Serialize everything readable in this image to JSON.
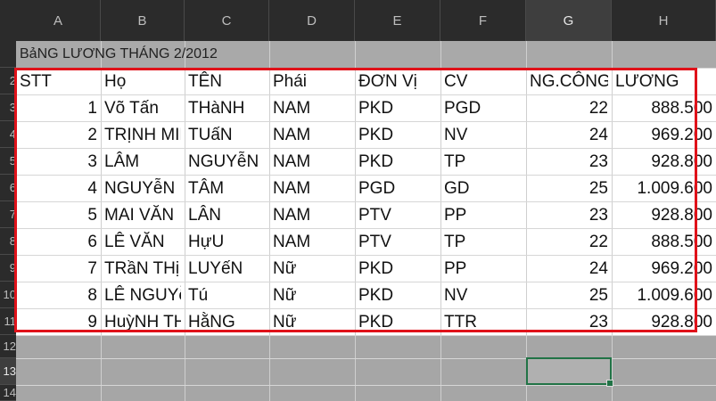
{
  "columns": [
    "A",
    "B",
    "C",
    "D",
    "E",
    "F",
    "G",
    "H"
  ],
  "row_numbers": [
    "",
    "2",
    "3",
    "4",
    "5",
    "6",
    "7",
    "8",
    "9",
    "10",
    "11",
    "12",
    "13",
    "14"
  ],
  "title": "BảNG LƯƠNG THÁNG 2/2012",
  "headers": [
    "STT",
    "Họ",
    "TÊN",
    "Phái",
    "ĐƠN Vị",
    "CV",
    "NG.CÔNG",
    "LƯƠNG"
  ],
  "rows": [
    [
      "1",
      "Võ Tấn",
      "THàNH",
      "NAM",
      "PKD",
      "PGD",
      "22",
      "888.500"
    ],
    [
      "2",
      "TRỊNH MIN",
      "TUấN",
      "NAM",
      "PKD",
      "NV",
      "24",
      "969.200"
    ],
    [
      "3",
      "LÂM",
      "NGUYễN",
      "NAM",
      "PKD",
      "TP",
      "23",
      "928.800"
    ],
    [
      "4",
      "NGUYễN N",
      "TÂM",
      "NAM",
      "PGD",
      "GD",
      "25",
      "1.009.600"
    ],
    [
      "5",
      "MAI VĂN",
      "LÂN",
      "NAM",
      "PTV",
      "PP",
      "23",
      "928.800"
    ],
    [
      "6",
      "LÊ VĂN",
      "HựU",
      "NAM",
      "PTV",
      "TP",
      "22",
      "888.500"
    ],
    [
      "7",
      "TRầN THị",
      "LUYếN",
      "Nữ",
      "PKD",
      "PP",
      "24",
      "969.200"
    ],
    [
      "8",
      "LÊ NGUYễ",
      "Tú",
      "Nữ",
      "PKD",
      "NV",
      "25",
      "1.009.600"
    ],
    [
      "9",
      "HuỳNH TH",
      "HằNG",
      "Nữ",
      "PKD",
      "TTR",
      "23",
      "928.800"
    ]
  ],
  "colors": {
    "highlight_box": "#e0121a",
    "active_cell": "#217346"
  }
}
